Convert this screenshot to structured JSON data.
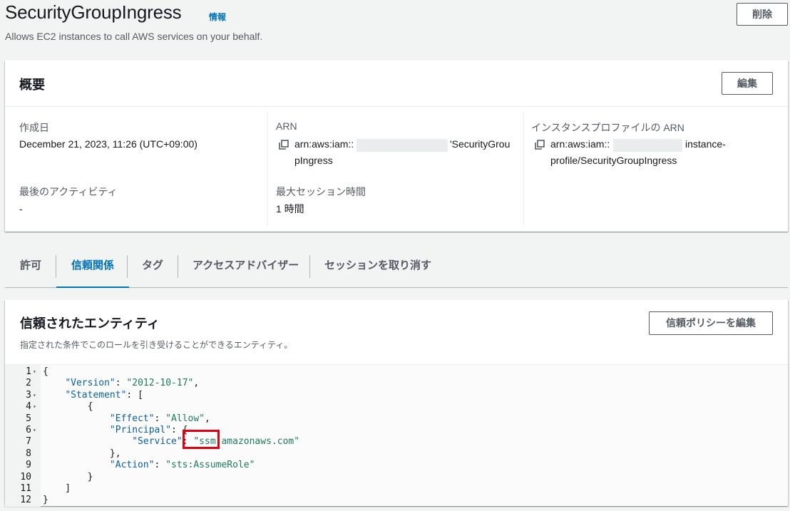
{
  "header": {
    "title": "SecurityGroupIngress",
    "info_link": "情報",
    "description": "Allows EC2 instances to call AWS services on your behalf.",
    "delete_label": "削除"
  },
  "summary": {
    "title": "概要",
    "edit_label": "編集",
    "created_label": "作成日",
    "created_value": "December 21, 2023, 11:26 (UTC+09:00)",
    "last_activity_label": "最後のアクティビティ",
    "last_activity_value": "-",
    "arn_label": "ARN",
    "arn_prefix": "arn:aws:iam::",
    "arn_suffix_1": "'SecurityGrou",
    "arn_suffix_2": "pIngress",
    "max_session_label": "最大セッション時間",
    "max_session_value": "1 時間",
    "profile_arn_label": "インスタンスプロファイルの ARN",
    "profile_arn_prefix": "arn:aws:iam::",
    "profile_arn_suffix_1": "instance-",
    "profile_arn_suffix_2": "profile/SecurityGroupIngress"
  },
  "tabs": [
    "許可",
    "信頼関係",
    "タグ",
    "アクセスアドバイザー",
    "セッションを取り消す"
  ],
  "active_tab": "信頼関係",
  "trust": {
    "title": "信頼されたエンティティ",
    "description": "指定された条件でこのロールを引き受けることができるエンティティ。",
    "edit_policy_label": "信頼ポリシーを編集"
  },
  "code_lines": [
    {
      "n": "1",
      "fold": true,
      "text": "{"
    },
    {
      "n": "2",
      "fold": false,
      "text": "    \"Version\": \"2012-10-17\","
    },
    {
      "n": "3",
      "fold": true,
      "text": "    \"Statement\": ["
    },
    {
      "n": "4",
      "fold": true,
      "text": "        {"
    },
    {
      "n": "5",
      "fold": false,
      "text": "            \"Effect\": \"Allow\","
    },
    {
      "n": "6",
      "fold": true,
      "text": "            \"Principal\": {"
    },
    {
      "n": "7",
      "fold": false,
      "text": "                \"Service\": \"ssm.amazonaws.com\""
    },
    {
      "n": "8",
      "fold": false,
      "text": "            },"
    },
    {
      "n": "9",
      "fold": false,
      "text": "            \"Action\": \"sts:AssumeRole\""
    },
    {
      "n": "10",
      "fold": false,
      "text": "        }"
    },
    {
      "n": "11",
      "fold": false,
      "text": "    ]"
    },
    {
      "n": "12",
      "fold": false,
      "text": "}"
    }
  ],
  "colors": {
    "accent": "#0073bb",
    "highlight": "#e3000f"
  }
}
